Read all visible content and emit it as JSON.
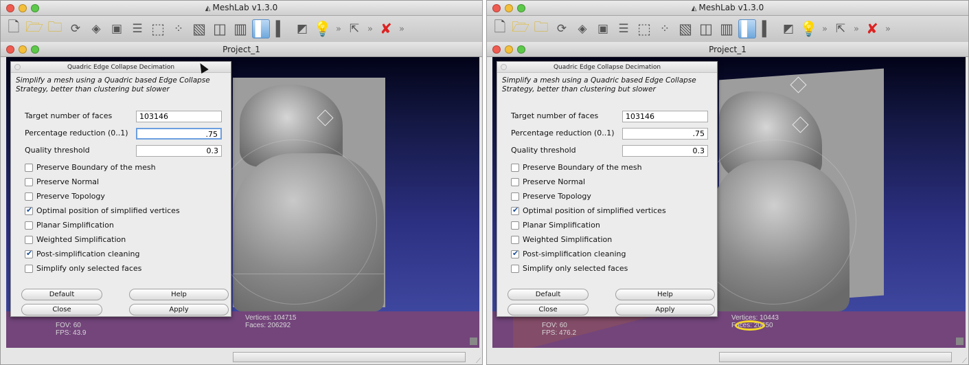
{
  "window_title": "MeshLab v1.3.0",
  "project_title": "Project_1",
  "toolbar_icons": [
    "new-doc-icon",
    "open-folder-icon",
    "open-project-icon",
    "reload-icon",
    "save-icon",
    "snapshot-icon",
    "layers-icon",
    "bounding-box-icon",
    "points-icon",
    "wireframe-icon",
    "hidden-lines-icon",
    "flat-lines-icon",
    "flat-icon",
    "smooth-icon",
    "texture-icon",
    "light-icon",
    "chevron-right-icon",
    "select-icon",
    "chevron-right-icon",
    "delete-icon",
    "chevron-right-icon"
  ],
  "dialog": {
    "title": "Quadric Edge Collapse Decimation",
    "description": "Simplify a mesh using a Quadric based Edge Collapse Strategy, better than clustering but slower",
    "fields": [
      {
        "label": "Target number of faces",
        "value": "103146"
      },
      {
        "label": "Percentage reduction (0..1)",
        "value": ".75"
      },
      {
        "label": "Quality threshold",
        "value": "0.3"
      }
    ],
    "checkboxes": [
      {
        "label": "Preserve Boundary of the mesh",
        "checked": false
      },
      {
        "label": "Preserve Normal",
        "checked": false
      },
      {
        "label": "Preserve Topology",
        "checked": false
      },
      {
        "label": "Optimal position of simplified vertices",
        "checked": true
      },
      {
        "label": "Planar Simplification",
        "checked": false
      },
      {
        "label": "Weighted Simplification",
        "checked": false
      },
      {
        "label": "Post-simplification cleaning",
        "checked": true
      },
      {
        "label": "Simplify only selected faces",
        "checked": false
      }
    ],
    "buttons": {
      "default": "Default",
      "help": "Help",
      "close": "Close",
      "apply": "Apply"
    }
  },
  "left": {
    "fov_label": "FOV: 60",
    "fps_label": "FPS:  43.9",
    "vertices_label": "Vertices: 104715",
    "faces_label": "Faces: 206292"
  },
  "right": {
    "fov_label": "FOV: 60",
    "fps_label": "FPS:  476.2",
    "vertices_label": "Vertices: 10443",
    "faces_label": "Faces: 20650"
  },
  "colors": {
    "highlight_ring": "#f3d629",
    "viewport_top": "#020318",
    "viewport_bottom": "#4550aa",
    "floor": "#73457b"
  }
}
